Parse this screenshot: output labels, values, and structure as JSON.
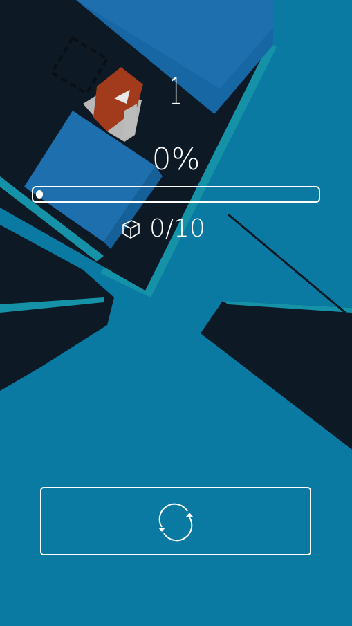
{
  "game": {
    "level": "1",
    "progress_text": "0%",
    "progress_fraction": 0,
    "cubes_text": "0/10"
  },
  "icons": {
    "cube": "cube-outline-icon",
    "restart": "restart-icon"
  },
  "colors": {
    "water": "#0a7aa3",
    "dark": "#0d1924",
    "teal_edge": "#1592a8",
    "block_blue": "#1667a4",
    "block_blue_light": "#2479b6",
    "character_orange": "#a13b1c",
    "character_grey": "#b8b8b8",
    "hud_white": "#ffffff"
  }
}
